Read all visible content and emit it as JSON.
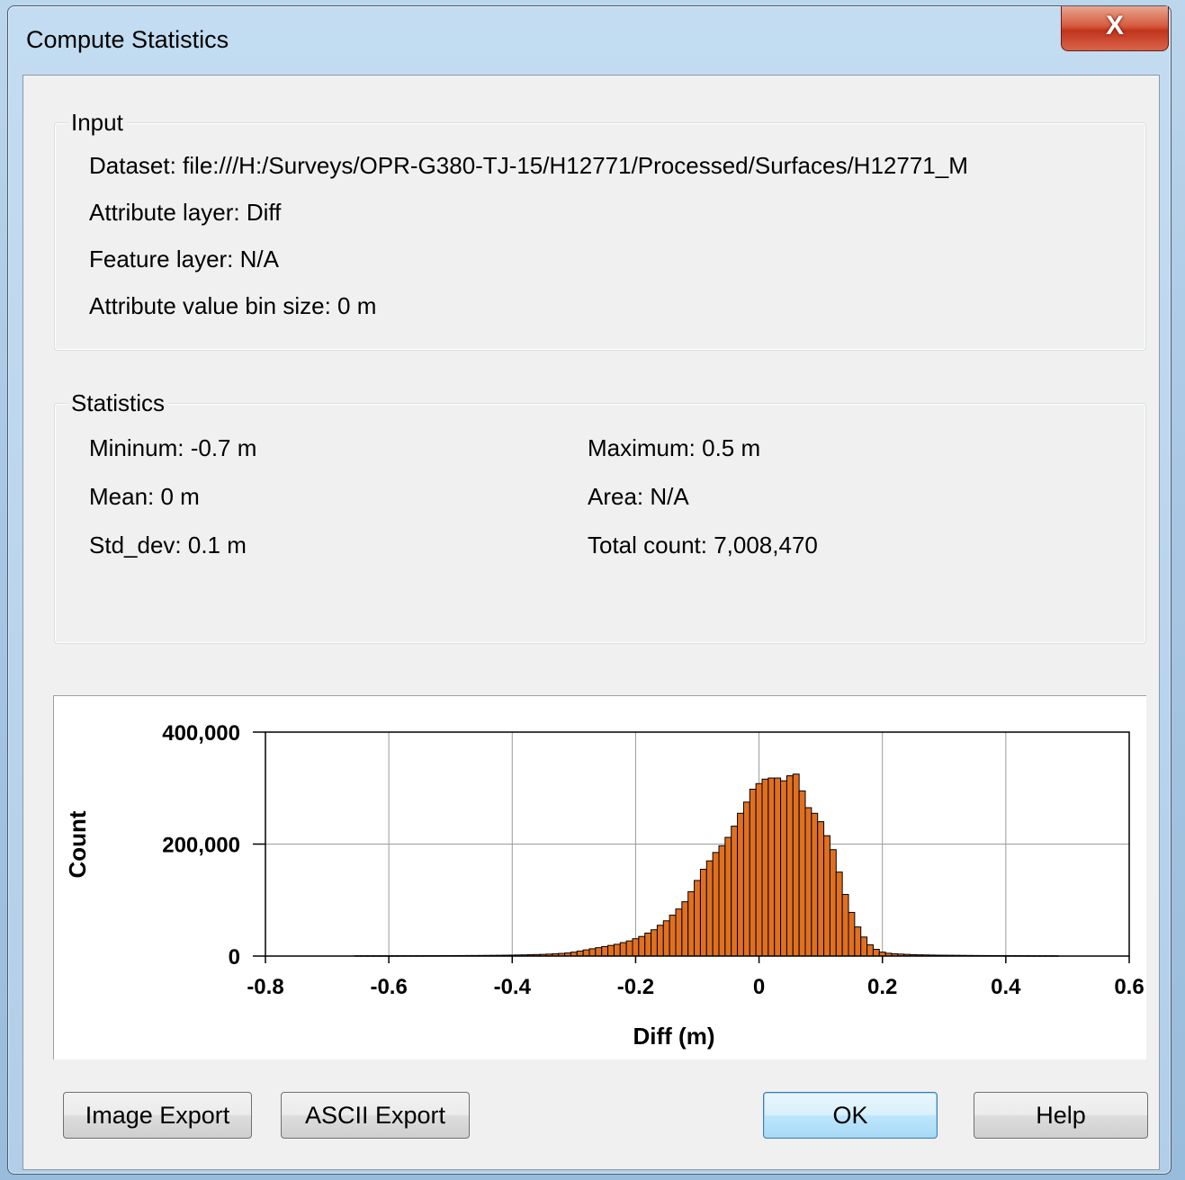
{
  "window": {
    "title": "Compute Statistics",
    "close_glyph": "X"
  },
  "input": {
    "legend": "Input",
    "dataset": "Dataset:  file:///H:/Surveys/OPR-G380-TJ-15/H12771/Processed/Surfaces/H12771_M",
    "attribute_layer": "Attribute layer:  Diff",
    "feature_layer": "Feature layer:  N/A",
    "bin_size": "Attribute value bin size:  0 m"
  },
  "statistics": {
    "legend": "Statistics",
    "minimum": "Mininum:  -0.7 m",
    "maximum": "Maximum:  0.5 m",
    "mean": "Mean:  0 m",
    "area": "Area:  N/A",
    "std_dev": "Std_dev:  0.1 m",
    "total_count": "Total count:  7,008,470"
  },
  "chart_data": {
    "type": "bar",
    "xlabel": "Diff (m)",
    "ylabel": "Count",
    "xlim": [
      -0.8,
      0.6
    ],
    "ylim": [
      0,
      400000
    ],
    "x_ticks": [
      -0.8,
      -0.6,
      -0.4,
      -0.2,
      0,
      0.2,
      0.4,
      0.6
    ],
    "x_tick_labels": [
      "-0.8",
      "-0.6",
      "-0.4",
      "-0.2",
      "0",
      "0.2",
      "0.4",
      "0.6"
    ],
    "y_ticks": [
      0,
      200000,
      400000
    ],
    "y_tick_labels": [
      "0",
      "200,000",
      "400,000"
    ],
    "grid": true,
    "bar_color": "#e07020",
    "bin_width": 0.01,
    "x": [
      -0.65,
      -0.64,
      -0.63,
      -0.62,
      -0.61,
      -0.6,
      -0.59,
      -0.58,
      -0.57,
      -0.56,
      -0.55,
      -0.54,
      -0.53,
      -0.52,
      -0.51,
      -0.5,
      -0.49,
      -0.48,
      -0.47,
      -0.46,
      -0.45,
      -0.44,
      -0.43,
      -0.42,
      -0.41,
      -0.4,
      -0.39,
      -0.38,
      -0.37,
      -0.36,
      -0.35,
      -0.34,
      -0.33,
      -0.32,
      -0.31,
      -0.3,
      -0.29,
      -0.28,
      -0.27,
      -0.26,
      -0.25,
      -0.24,
      -0.23,
      -0.22,
      -0.21,
      -0.2,
      -0.19,
      -0.18,
      -0.17,
      -0.16,
      -0.15,
      -0.14,
      -0.13,
      -0.12,
      -0.11,
      -0.1,
      -0.09,
      -0.08,
      -0.07,
      -0.06,
      -0.05,
      -0.04,
      -0.03,
      -0.02,
      -0.01,
      0.0,
      0.01,
      0.02,
      0.03,
      0.04,
      0.05,
      0.06,
      0.07,
      0.08,
      0.09,
      0.1,
      0.11,
      0.12,
      0.13,
      0.14,
      0.15,
      0.16,
      0.17,
      0.18,
      0.19,
      0.2,
      0.21,
      0.22,
      0.23,
      0.24,
      0.25,
      0.26,
      0.27,
      0.28,
      0.29,
      0.3,
      0.31,
      0.32,
      0.33,
      0.34,
      0.35,
      0.36,
      0.37,
      0.38,
      0.39,
      0.4,
      0.41,
      0.42,
      0.43,
      0.44,
      0.45,
      0.46,
      0.47,
      0.48
    ],
    "values": [
      500,
      500,
      500,
      500,
      500,
      500,
      500,
      600,
      600,
      600,
      600,
      700,
      700,
      700,
      800,
      800,
      900,
      900,
      1000,
      1000,
      1100,
      1200,
      1300,
      1400,
      1500,
      1700,
      1900,
      2100,
      2400,
      2700,
      3000,
      3500,
      4000,
      4700,
      5500,
      7000,
      9000,
      11000,
      13000,
      15000,
      17000,
      19000,
      21000,
      24000,
      27000,
      31000,
      35000,
      41000,
      47000,
      55000,
      63000,
      73000,
      84000,
      97000,
      115000,
      135000,
      155000,
      170000,
      185000,
      197000,
      212000,
      232000,
      255000,
      275000,
      298000,
      308000,
      316000,
      318000,
      318000,
      313000,
      322000,
      325000,
      295000,
      265000,
      255000,
      240000,
      215000,
      190000,
      150000,
      110000,
      78000,
      52000,
      34000,
      20000,
      12000,
      7000,
      5000,
      4000,
      3500,
      3000,
      2500,
      2200,
      2000,
      1800,
      1600,
      1500,
      1400,
      1300,
      1200,
      1100,
      1000,
      950,
      900,
      850,
      800,
      750,
      700,
      650,
      600,
      550,
      500,
      500,
      500,
      500
    ]
  },
  "buttons": {
    "image_export": "Image Export",
    "ascii_export": "ASCII Export",
    "ok": "OK",
    "help": "Help"
  }
}
